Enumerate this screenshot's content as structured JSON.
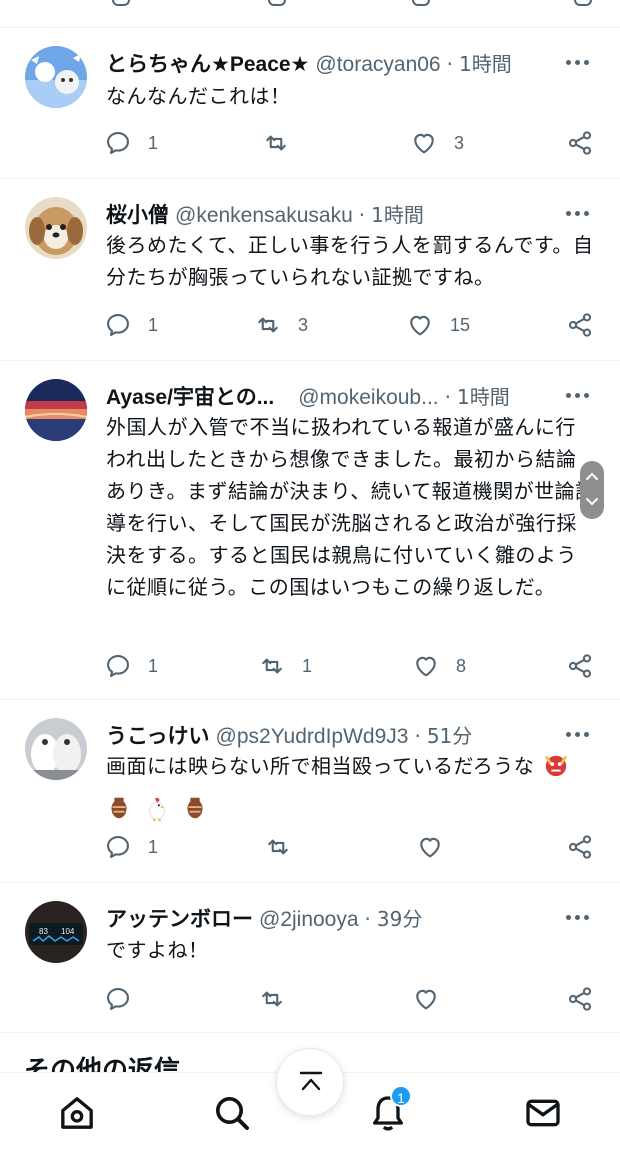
{
  "tweets": [
    {
      "name": "とらちゃん★Peace★",
      "handle": "@toracyan06",
      "sep": "·",
      "time": "1時間",
      "text": "なんなんだこれは！",
      "reply_count": "1",
      "retweet_count": "",
      "like_count": "3"
    },
    {
      "name": "桜小僧",
      "handle": "@kenkensakusaku",
      "sep": "·",
      "time": "1時間",
      "text": "後ろめたくて、正しい事を行う人を罰するんです。自分たちが胸張っていられない証拠ですね。",
      "reply_count": "1",
      "retweet_count": "3",
      "like_count": "15"
    },
    {
      "name": "Ayase/宇宙との...",
      "handle": "@mokeikoub...",
      "sep": "·",
      "time": "1時間",
      "text": "外国人が入管で不当に扱われている報道が盛んに行われ出したときから想像できました。最初から結論ありき。まず結論が決まり、続いて報道機関が世論誘導を行い、そして国民が洗脳されると政治が強行採決をする。すると国民は親鳥に付いていく雛のように従順に従う。この国はいつもこの繰り返しだ。",
      "reply_count": "1",
      "retweet_count": "1",
      "like_count": "8"
    },
    {
      "name": "うこっけい",
      "handle": "@ps2YudrdIpWd9J3",
      "sep": "·",
      "time": "51分",
      "text": "画面には映らない所で相当殴っているだろうな",
      "reply_count": "1",
      "retweet_count": "",
      "like_count": ""
    },
    {
      "name": "アッテンボロー",
      "handle": "@2jinooya",
      "sep": "·",
      "time": "39分",
      "text": "ですよね！",
      "reply_count": "",
      "retweet_count": "",
      "like_count": ""
    }
  ],
  "avatar4_screen": {
    "left": "83",
    "right": "104"
  },
  "more_replies_heading": "その他の返信",
  "nav": {
    "home_icon": "home-icon",
    "search_icon": "search-icon",
    "notifications_icon": "bell-icon",
    "notification_badge": "1",
    "messages_icon": "mail-icon"
  },
  "colors": {
    "accent": "#1d9bf0",
    "muted": "#536471",
    "text": "#0f1419"
  }
}
